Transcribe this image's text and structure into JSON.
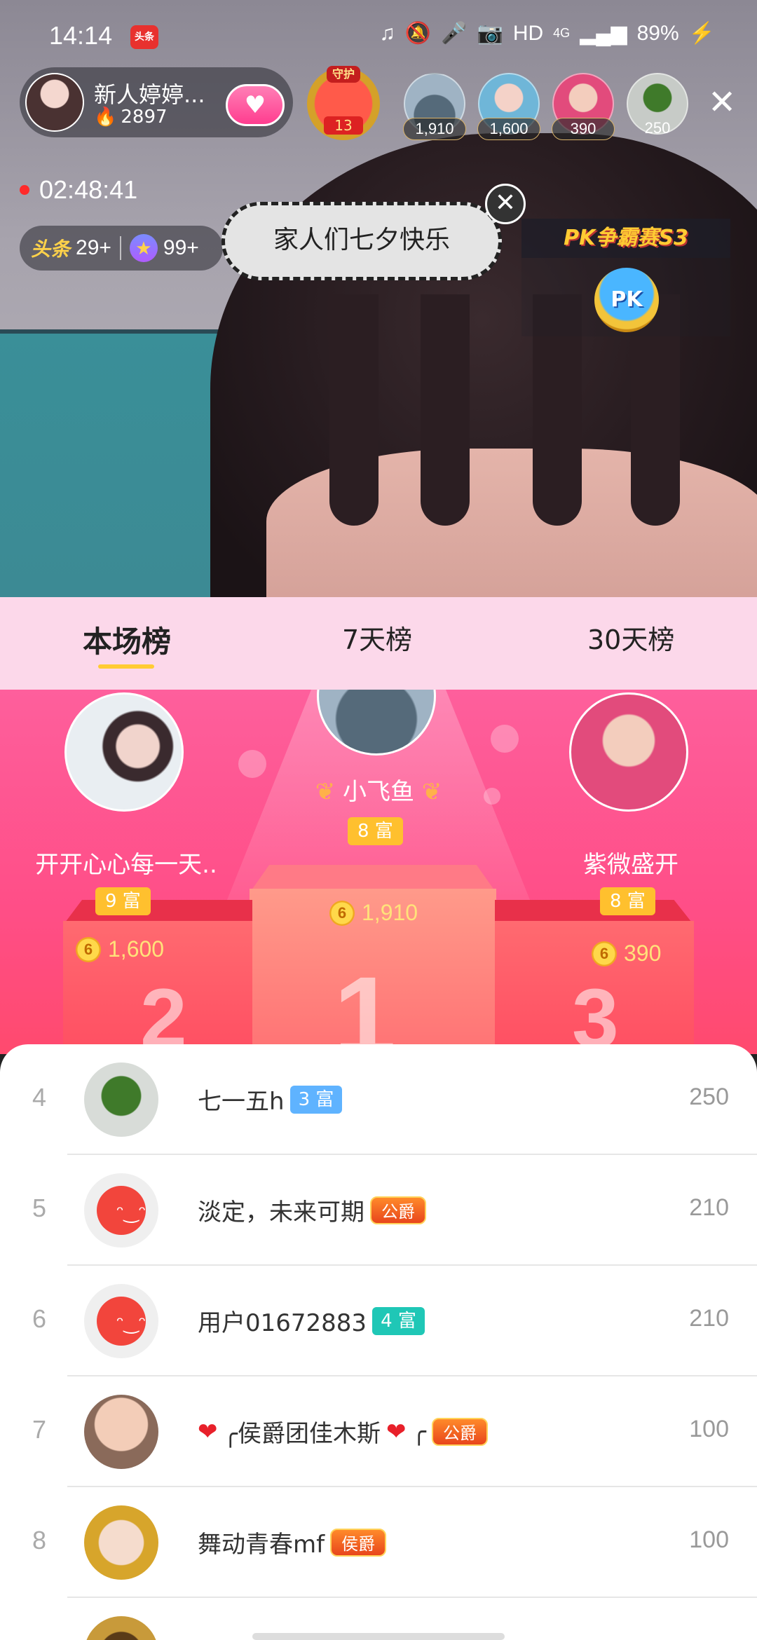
{
  "status_bar": {
    "time": "14:14",
    "app_badge": "头条",
    "hd": "HD",
    "network": "4G",
    "battery": "89%"
  },
  "anchor": {
    "name": "新人婷婷...",
    "heat": "2897"
  },
  "guard": {
    "label": "守护",
    "count": "13"
  },
  "viewers": [
    {
      "count": "1,910"
    },
    {
      "count": "1,600"
    },
    {
      "count": "390"
    },
    {
      "count": "250"
    }
  ],
  "live_timer": "02:48:41",
  "rank_pill": {
    "toutiao_label": "头条",
    "toutiao_count": "29+",
    "star_count": "99+"
  },
  "bubble_message": "家人们七夕快乐",
  "pk": {
    "banner": "PK争霸赛S3",
    "button": "PK"
  },
  "tabs": [
    {
      "label": "本场榜"
    },
    {
      "label": "7天榜"
    },
    {
      "label": "30天榜"
    }
  ],
  "podium": {
    "first": {
      "name": "小飞鱼",
      "level": "8 富",
      "score": "1,910",
      "stand": "1"
    },
    "second": {
      "name": "开开心心每一天..",
      "level": "9 富",
      "score": "1,600",
      "stand": "2"
    },
    "third": {
      "name": "紫微盛开",
      "level": "8 富",
      "score": "390",
      "stand": "3"
    }
  },
  "list": [
    {
      "rank": "4",
      "name": "七一五h",
      "badge": "3 富",
      "badge_type": "wealth-blue",
      "score": "250"
    },
    {
      "rank": "5",
      "name": "淡定，未来可期",
      "badge": "公爵",
      "badge_type": "noble",
      "score": "210"
    },
    {
      "rank": "6",
      "name": "用户01672883",
      "badge": "4 富",
      "badge_type": "wealth-teal",
      "score": "210"
    },
    {
      "rank": "7",
      "name": "╭侯爵团佳木斯",
      "name_suffix": "╭",
      "badge": "公爵",
      "badge_type": "noble",
      "score": "100"
    },
    {
      "rank": "8",
      "name": "舞动青春mf",
      "badge": "侯爵",
      "badge_type": "noble",
      "score": "100"
    }
  ],
  "coin_symbol": "6",
  "colors": {
    "tab_bg": "#fcd8ea",
    "podium_pink": "#ff4e87",
    "accent_yellow": "#ffcc33"
  }
}
